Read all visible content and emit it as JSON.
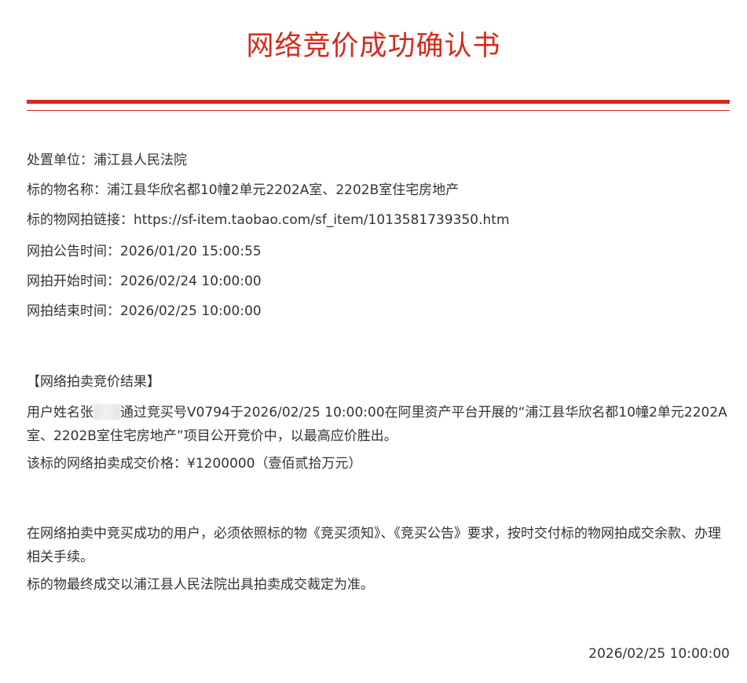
{
  "document": {
    "title": "网络竞价成功确认书",
    "accent_color": "#d8291b"
  },
  "info": {
    "disposal_unit": "处置单位：浦江县人民法院",
    "item_name": "标的物名称：浦江县华欣名都10幢2单元2202A室、2202B室住宅房地产",
    "item_link": "标的物网拍链接：https://sf-item.taobao.com/sf_item/1013581739350.htm",
    "announce_time": "网拍公告时间：2026/01/20 15:00:55",
    "start_time": "网拍开始时间：2026/02/24 10:00:00",
    "end_time": "网拍结束时间：2026/02/25 10:00:00"
  },
  "result": {
    "heading": "【网络拍卖竞价结果】",
    "text_before_name": "用户姓名张",
    "text_after_name": "通过竞买号V0794于2026/02/25 10:00:00在阿里资产平台开展的“浦江县华欣名都10幢2单元2202A室、2202B室住宅房地产”项目公开竞价中，以最高应价胜出。",
    "price": "该标的网络拍卖成交价格：¥1200000（壹佰贰拾万元）"
  },
  "notice": {
    "paragraph1": "在网络拍卖中竞买成功的用户，必须依照标的物《竞买须知》、《竞买公告》要求，按时交付标的物网拍成交余款、办理相关手续。",
    "paragraph2": "标的物最终成交以浦江县人民法院出具拍卖成交裁定为准。"
  },
  "footer": {
    "date": "2026/02/25 10:00:00"
  }
}
